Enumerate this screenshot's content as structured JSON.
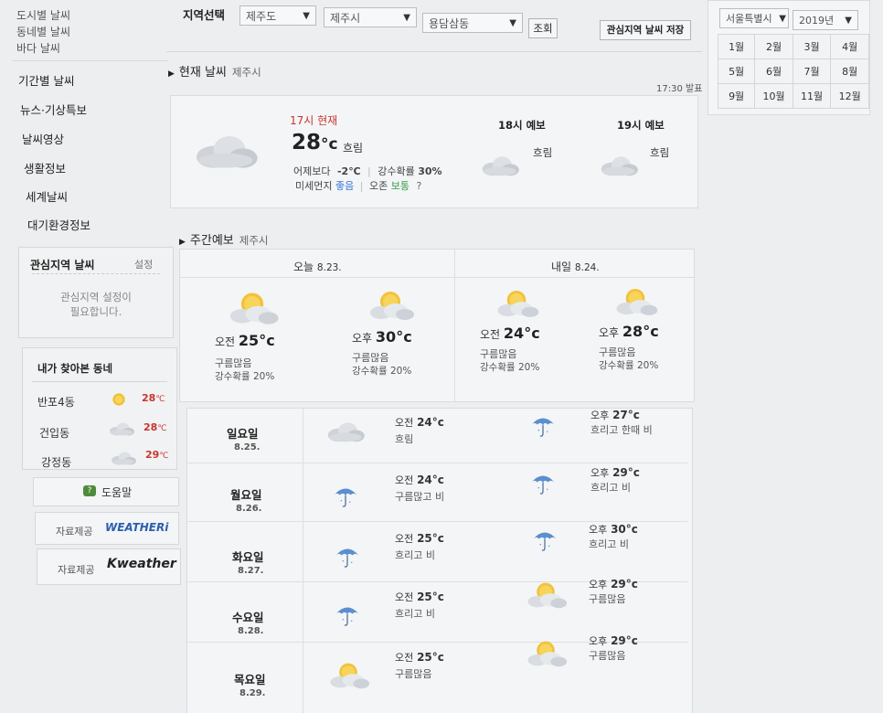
{
  "sidebar": {
    "top_items": [
      "도시별 날씨",
      "동네별 날씨",
      "바다 날씨"
    ],
    "menu": [
      "기간별 날씨",
      "뉴스·기상특보",
      "날씨영상",
      "생활정보",
      "세계날씨",
      "대기환경정보"
    ],
    "favorites": {
      "title": "관심지역 날씨",
      "settings": "설정",
      "message_line1": "관심지역 설정이",
      "message_line2": "필요합니다."
    },
    "visited": {
      "title": "내가 찾아본 동네",
      "items": [
        {
          "name": "반포4동",
          "temp": "28",
          "icon": "sun-icon"
        },
        {
          "name": "건입동",
          "temp": "28",
          "icon": "cloud-icon"
        },
        {
          "name": "강정동",
          "temp": "29",
          "icon": "cloud-icon"
        }
      ],
      "unit": "℃"
    },
    "help": "도움말",
    "provider1_label": "자료제공",
    "provider1_name": "WEATHERi",
    "provider2_label": "자료제공",
    "provider2_name": "Kweather"
  },
  "region": {
    "label": "지역선택",
    "province": "제주도",
    "city": "제주시",
    "town": "용담삼동",
    "search_button": "조회",
    "save_button": "관심지역 날씨 저장"
  },
  "current": {
    "section_title": "현재 날씨",
    "location": "제주시",
    "issued": "17:30 발표",
    "now_label": "17시 현재",
    "temp": "28",
    "unit": "°c",
    "condition": "흐림",
    "yesterday_label": "어제보다",
    "yesterday_diff": "-2℃",
    "rain_label": "강수확률",
    "rain_value": "30%",
    "dust_label": "미세먼지",
    "dust_value": "좋음",
    "ozone_label": "오존",
    "ozone_value": "보통",
    "help_mark": "?",
    "forecast": [
      {
        "label": "18시 예보",
        "condition": "흐림"
      },
      {
        "label": "19시 예보",
        "condition": "흐림"
      }
    ]
  },
  "weekly": {
    "section_title": "주간예보",
    "location": "제주시",
    "today_label": "오늘",
    "today_date": "8.23.",
    "tomorrow_label": "내일",
    "tomorrow_date": "8.24.",
    "top": [
      {
        "ampm": "오전",
        "temp": "25°c",
        "desc": "구름많음",
        "rain": "강수확률 20%"
      },
      {
        "ampm": "오후",
        "temp": "30°c",
        "desc": "구름많음",
        "rain": "강수확률 20%"
      },
      {
        "ampm": "오전",
        "temp": "24°c",
        "desc": "구름많음",
        "rain": "강수확률 20%"
      },
      {
        "ampm": "오후",
        "temp": "28°c",
        "desc": "구름많음",
        "rain": "강수확률 20%"
      }
    ],
    "days": [
      {
        "day": "일요일",
        "date": "8.25.",
        "am_ampm": "오전",
        "am_temp": "24°c",
        "am_desc": "흐림",
        "am_icon": "cloud",
        "pm_ampm": "오후",
        "pm_temp": "27°c",
        "pm_desc": "흐리고 한때 비",
        "pm_icon": "umbrella"
      },
      {
        "day": "월요일",
        "date": "8.26.",
        "am_ampm": "오전",
        "am_temp": "24°c",
        "am_desc": "구름많고 비",
        "am_icon": "umbrella",
        "pm_ampm": "오후",
        "pm_temp": "29°c",
        "pm_desc": "흐리고 비",
        "pm_icon": "umbrella"
      },
      {
        "day": "화요일",
        "date": "8.27.",
        "am_ampm": "오전",
        "am_temp": "25°c",
        "am_desc": "흐리고 비",
        "am_icon": "umbrella",
        "pm_ampm": "오후",
        "pm_temp": "30°c",
        "pm_desc": "흐리고 비",
        "pm_icon": "umbrella"
      },
      {
        "day": "수요일",
        "date": "8.28.",
        "am_ampm": "오전",
        "am_temp": "25°c",
        "am_desc": "흐리고 비",
        "am_icon": "umbrella",
        "pm_ampm": "오후",
        "pm_temp": "29°c",
        "pm_desc": "구름많음",
        "pm_icon": "suncloud"
      },
      {
        "day": "목요일",
        "date": "8.29.",
        "am_ampm": "오전",
        "am_temp": "25°c",
        "am_desc": "구름많음",
        "am_icon": "suncloud",
        "pm_ampm": "오후",
        "pm_temp": "29°c",
        "pm_desc": "구름많음",
        "pm_icon": "suncloud"
      }
    ]
  },
  "calendar": {
    "region": "서울특별시",
    "year": "2019년",
    "months": [
      "1월",
      "2월",
      "3월",
      "4월",
      "5월",
      "6월",
      "7월",
      "8월",
      "9월",
      "10월",
      "11월",
      "12월"
    ]
  }
}
